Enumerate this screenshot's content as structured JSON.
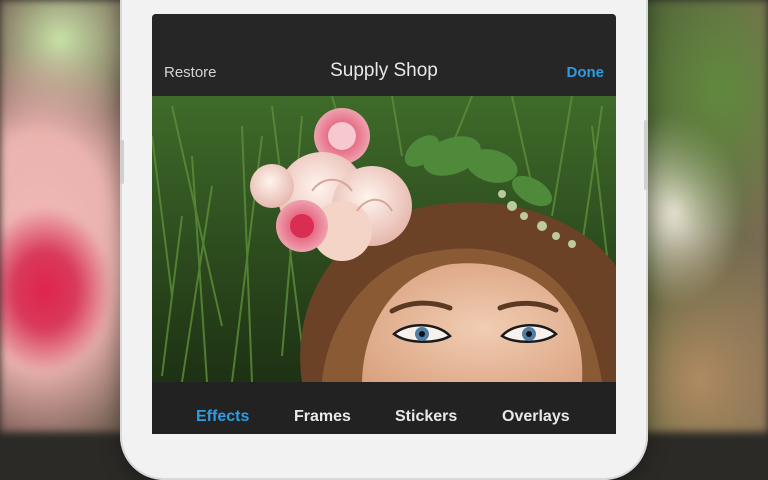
{
  "navbar": {
    "left_label": "Restore",
    "title": "Supply Shop",
    "right_label": "Done"
  },
  "tabs": [
    {
      "label": "Effects",
      "active": true
    },
    {
      "label": "Frames",
      "active": false
    },
    {
      "label": "Stickers",
      "active": false
    },
    {
      "label": "Overlays",
      "active": false
    }
  ],
  "colors": {
    "accent": "#2f9be0",
    "screen_bg": "#242424"
  }
}
